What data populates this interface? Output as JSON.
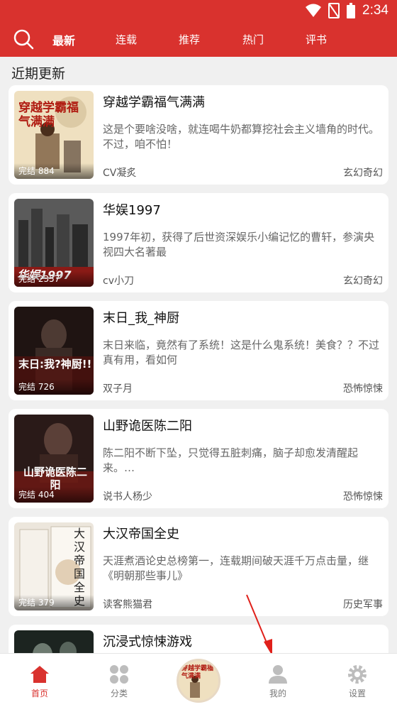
{
  "status_bar": {
    "time": "2:34"
  },
  "nav": {
    "tabs": [
      {
        "label": "最新",
        "active": true
      },
      {
        "label": "连载",
        "active": false
      },
      {
        "label": "推荐",
        "active": false
      },
      {
        "label": "热门",
        "active": false
      },
      {
        "label": "评书",
        "active": false
      }
    ],
    "accent": "#d9322e"
  },
  "section": {
    "title": "近期更新"
  },
  "books": [
    {
      "title": "穿越学霸福气满满",
      "desc": "这是个要啥没啥，就连喝牛奶都算挖社会主义墙角的时代。不过，咱不怕！",
      "author": "CV凝炙",
      "genre": "玄幻奇幻",
      "badge": "完结 884",
      "cover_text": "穿越学霸福气满满"
    },
    {
      "title": "华娱1997",
      "desc": "1997年初，获得了后世资深娱乐小编记忆的曹轩，参演央视四大名著最",
      "author": "cv小刀",
      "genre": "玄幻奇幻",
      "badge": "完结 2357",
      "cover_text": "华娱1997"
    },
    {
      "title": "末日_我_神厨",
      "desc": "末日来临，竟然有了系统！这是什么鬼系统！美食？？不过真有用，看如何",
      "author": "双子月",
      "genre": "恐怖惊悚",
      "badge": "完结 726",
      "cover_text": "末日:我?神厨!!"
    },
    {
      "title": "山野诡医陈二阳",
      "desc": " 陈二阳不断下坠，只觉得五脏刺痛，脑子却愈发清醒起来。…",
      "author": "说书人杨少",
      "genre": "恐怖惊悚",
      "badge": "完结 404",
      "cover_text": "山野诡医陈二阳"
    },
    {
      "title": "大汉帝国全史",
      "desc": "天涯煮酒论史总榜第一，连载期间破天涯千万点击量，继《明朝那些事儿》",
      "author": "读客熊猫君",
      "genre": "历史军事",
      "badge": "完结 379",
      "cover_text": "大汉帝国全史"
    },
    {
      "title": "沉浸式惊悚游戏"
    }
  ],
  "bottom_nav": [
    {
      "label": "首页",
      "icon": "home-icon",
      "active": true
    },
    {
      "label": "分类",
      "icon": "grid-icon",
      "active": false
    },
    {
      "label": "我的",
      "icon": "user-icon",
      "active": false
    },
    {
      "label": "设置",
      "icon": "gear-icon",
      "active": false
    }
  ]
}
